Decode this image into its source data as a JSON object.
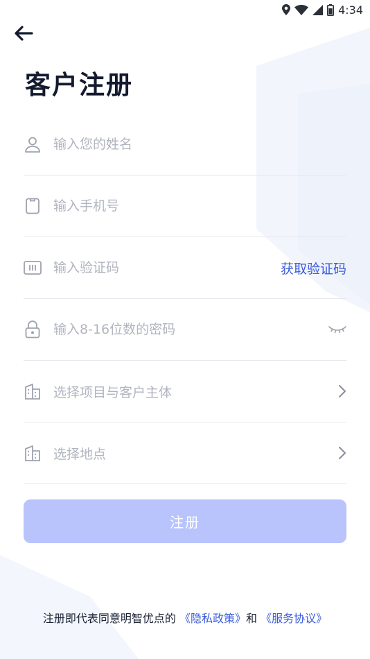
{
  "status_bar": {
    "time": "4:34"
  },
  "page": {
    "title": "客户注册"
  },
  "form": {
    "name_placeholder": "输入您的姓名",
    "phone_placeholder": "输入手机号",
    "code_placeholder": "输入验证码",
    "get_code_label": "获取验证码",
    "password_placeholder": "输入8-16位数的密码",
    "project_label": "选择项目与客户主体",
    "location_label": "选择地点"
  },
  "submit_label": "注册",
  "agreement": {
    "prefix": "注册即代表同意明智优点的",
    "privacy_link": "《隐私政策》",
    "and": "和",
    "service_link": "《服务协议》"
  },
  "colors": {
    "accent": "#3b5bdb",
    "button_disabled": "#b9c4fd",
    "placeholder": "#b2b5bf",
    "divider": "#e6e7ec"
  }
}
